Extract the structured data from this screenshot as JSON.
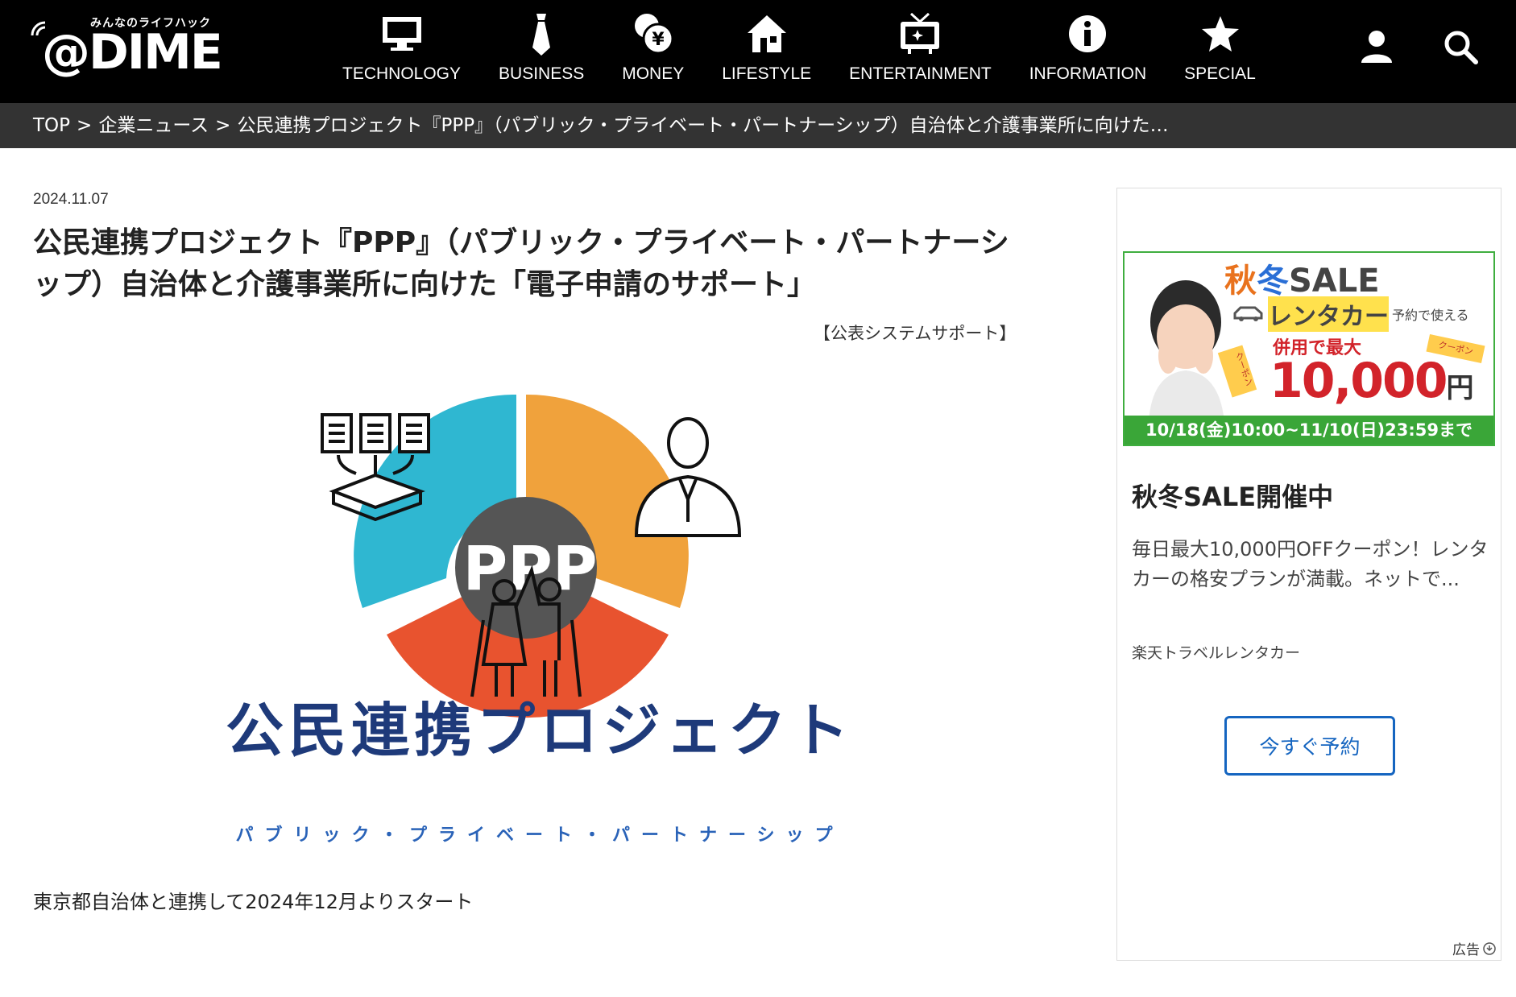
{
  "header": {
    "logo_sub": "みんなのライフハック",
    "logo_text": "@DIME",
    "nav": [
      {
        "label": "TECHNOLOGY",
        "icon": "monitor-icon"
      },
      {
        "label": "BUSINESS",
        "icon": "necktie-icon"
      },
      {
        "label": "MONEY",
        "icon": "yen-coin-icon"
      },
      {
        "label": "LIFESTYLE",
        "icon": "house-icon"
      },
      {
        "label": "ENTERTAINMENT",
        "icon": "tv-icon"
      },
      {
        "label": "INFORMATION",
        "icon": "info-icon"
      },
      {
        "label": "SPECIAL",
        "icon": "star-icon"
      }
    ],
    "user_icon": "user-icon",
    "search_icon": "search-icon"
  },
  "breadcrumb": {
    "items": [
      "TOP",
      "企業ニュース",
      "公民連携プロジェクト『PPP』（パブリック・プライベート・パートナーシップ）自治体と介護事業所に向けた…"
    ],
    "separator": ">"
  },
  "article": {
    "date": "2024.11.07",
    "title": "公民連携プロジェクト『PPP』（パブリック・プライベート・パートナーシップ）自治体と介護事業所に向けた「電子申請のサポート」",
    "source": "【公表システムサポート】",
    "hero": {
      "center_text": "PPP",
      "title_text": "公民連携プロジェクト",
      "subtitle_text": "パブリック・プライベート・パートナーシップ",
      "colors": {
        "blue": "#2fb7d1",
        "orange": "#f0a23c",
        "red": "#e8532f",
        "navy": "#1e3a7a",
        "dark": "#555555"
      }
    },
    "lead": "東京都自治体と連携して2024年12月よりスタート"
  },
  "ad": {
    "banner": {
      "sale_a": "秋",
      "sale_b": "冬",
      "sale_c": "SALE",
      "line2": "レンタカー",
      "line2_note": "予約で使える",
      "line3": "併用で最大",
      "amount": "10,000",
      "yen": "円",
      "coupon": "クーポン",
      "period": "10/18(金)10:00~11/10(日)23:59まで"
    },
    "heading": "秋冬SALE開催中",
    "description": "毎日最大10,000円OFFクーポン！レンタカーの格安プランが満載。ネットで...",
    "brand": "楽天トラベルレンタカー",
    "cta": "今すぐ予約",
    "label": "広告"
  }
}
